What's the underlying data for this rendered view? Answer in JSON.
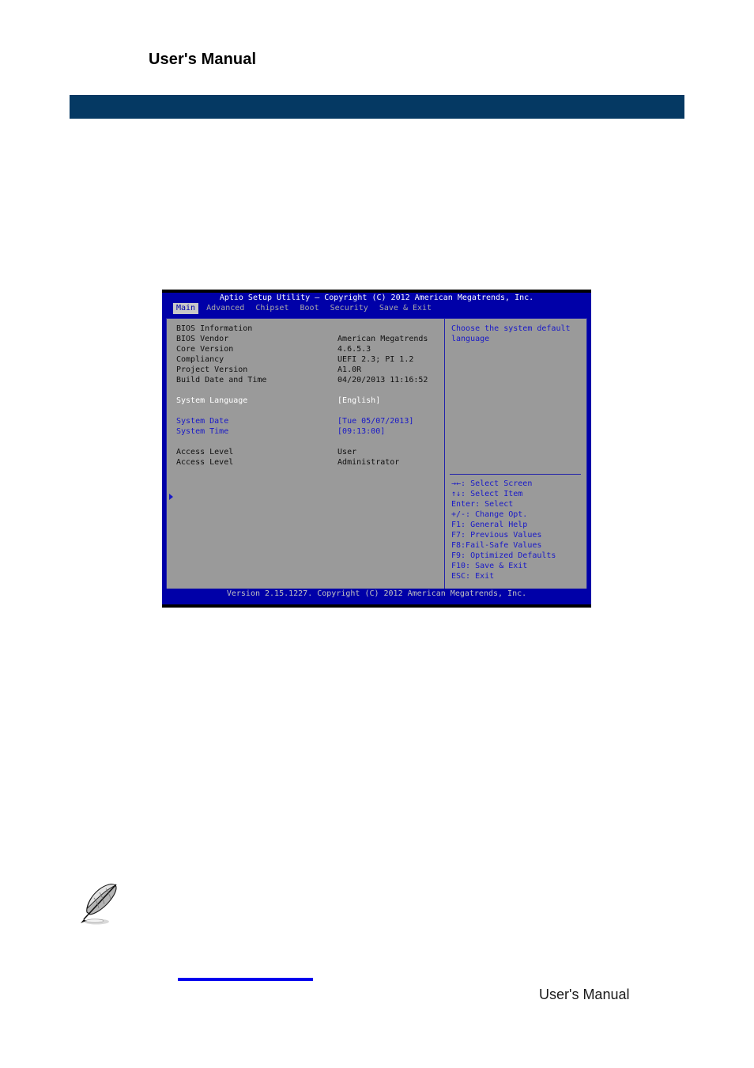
{
  "document": {
    "header_title": "User's Manual",
    "footer_title": "User's Manual",
    "header_bar_color": "#053963",
    "footer_rule_color": "#0000ee",
    "note_icon": "quill-feather-icon"
  },
  "bios": {
    "title": "Aptio Setup Utility – Copyright (C) 2012 American Megatrends, Inc.",
    "tabs": [
      {
        "label": "Main",
        "active": true
      },
      {
        "label": "Advanced",
        "active": false
      },
      {
        "label": "Chipset",
        "active": false
      },
      {
        "label": "Boot",
        "active": false
      },
      {
        "label": "Security",
        "active": false
      },
      {
        "label": "Save & Exit",
        "active": false
      }
    ],
    "section_title": "BIOS Information",
    "rows": [
      {
        "label": "BIOS Vendor",
        "value": "American Megatrends",
        "color": "black"
      },
      {
        "label": "Core Version",
        "value": "4.6.5.3",
        "color": "black"
      },
      {
        "label": "Compliancy",
        "value": "UEFI 2.3; PI 1.2",
        "color": "black"
      },
      {
        "label": "Project Version",
        "value": "A1.0R",
        "color": "black"
      },
      {
        "label": "Build Date and Time",
        "value": "04/20/2013 11:16:52",
        "color": "black"
      }
    ],
    "language_row": {
      "label": "System Language",
      "value": "[English]",
      "color": "white"
    },
    "date_row": {
      "label": "System Date",
      "value": "[Tue 05/07/2013]",
      "color": "blue"
    },
    "time_row": {
      "label": "System Time",
      "value": "[09:13:00]",
      "color": "blue"
    },
    "access_rows": [
      {
        "label": "Access Level",
        "value": "User",
        "color": "black"
      },
      {
        "label": "Access Level",
        "value": "Administrator",
        "color": "black"
      }
    ],
    "help": {
      "line1": "Choose the system default",
      "line2": "language"
    },
    "keys": [
      "→←: Select Screen",
      "↑↓: Select Item",
      "Enter: Select",
      "+/-: Change Opt.",
      "F1: General Help",
      "F7: Previous Values",
      "F8:Fail-Safe Values",
      "F9: Optimized Defaults",
      "F10: Save & Exit",
      "ESC: Exit"
    ],
    "version_bar": "Version 2.15.1227. Copyright (C) 2012 American Megatrends, Inc."
  }
}
